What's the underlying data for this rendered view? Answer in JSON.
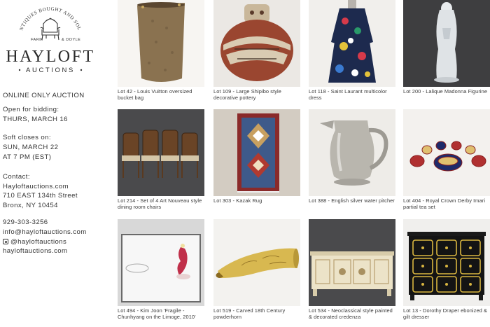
{
  "brand": {
    "arc_text": "ANTIQUES BOUGHT AND SOLD",
    "est_left": "FARM",
    "est_right": "& DOYLE",
    "name": "HAYLOFT",
    "sub": "AUCTIONS"
  },
  "info": {
    "headline": "ONLINE ONLY AUCTION",
    "open_label": "Open for bidding:",
    "open_date": "THURS, MARCH 16",
    "soft_label": "Soft closes on:",
    "soft_date": "SUN, MARCH 22",
    "soft_time": "AT 7 PM (EST)",
    "contact_label": "Contact:",
    "website": "Hayloftauctions.com",
    "street": "710 EAST 134th Street",
    "city": "Bronx, NY 10454",
    "phone": "929-303-3256",
    "email": "info@hayloftauctions.com",
    "instagram": "@hayloftauctions",
    "website2": "hayloftauctions.com"
  },
  "lots": [
    {
      "caption": "Lot 42 - Louis Vuitton oversized bucket bag",
      "icon": "bucket-bag"
    },
    {
      "caption": "Lot 109 - Large Shipibo style decorative pottery",
      "icon": "pottery"
    },
    {
      "caption": "Lot 118 - Saint Laurant multicolor dress",
      "icon": "dress"
    },
    {
      "caption": "Lot 200 - Lalique Madonna Figurine",
      "icon": "figurine"
    },
    {
      "caption": "Lot 214 - Set of 4 Art Nouveau style dining room chairs",
      "icon": "chairs"
    },
    {
      "caption": "Lot 303 - Kazak Rug",
      "icon": "rug"
    },
    {
      "caption": "Lot 388 - English silver water pitcher",
      "icon": "pitcher"
    },
    {
      "caption": "Lot 404 - Royal Crown Derby Imari partial tea set",
      "icon": "tea-set"
    },
    {
      "caption": "Lot 494 - Kim Joon 'Fragile -Chunhyang on the Limoge, 2010'",
      "icon": "sculpture"
    },
    {
      "caption": "Lot 519 - Carved 18th Century powderhorn",
      "icon": "powderhorn"
    },
    {
      "caption": "Lot 534 - Neoclassical style painted & decorated credenza",
      "icon": "credenza"
    },
    {
      "caption": "Lot 13 - Dorothy Draper ebonized & gilt dresser",
      "icon": "dresser"
    }
  ]
}
